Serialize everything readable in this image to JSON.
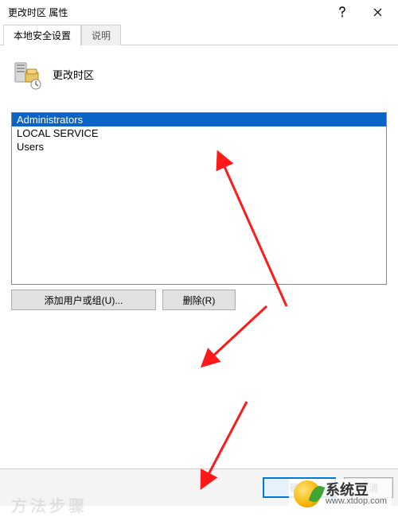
{
  "window": {
    "title": "更改时区 属性"
  },
  "tabs": {
    "active": "本地安全设置",
    "inactive": "说明"
  },
  "policy": {
    "name": "更改时区"
  },
  "principals": {
    "items": [
      {
        "name": "Administrators",
        "selected": true
      },
      {
        "name": "LOCAL SERVICE",
        "selected": false
      },
      {
        "name": "Users",
        "selected": false
      }
    ]
  },
  "buttons": {
    "add": "添加用户或组(U)...",
    "remove": "删除(R)",
    "ok": "确定",
    "cancel": "取消"
  },
  "background_text": "方法步骤",
  "watermark": {
    "name": "系统豆",
    "url": "www.xtdop.com"
  }
}
